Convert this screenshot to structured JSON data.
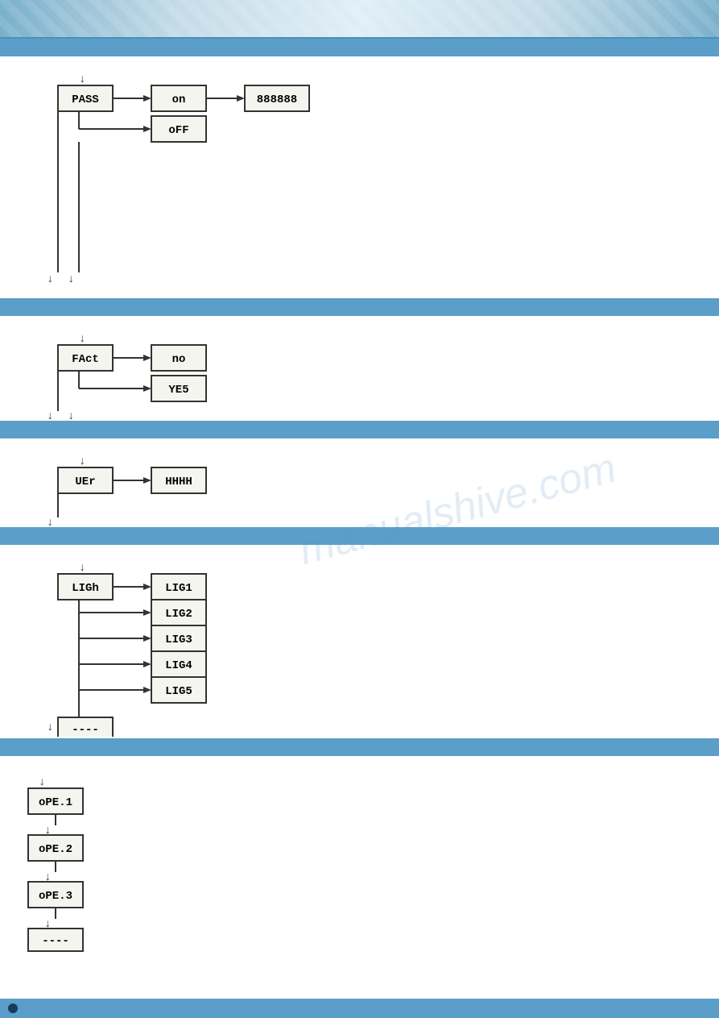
{
  "header": {
    "alt": "Product header banner"
  },
  "watermark": "manualshive.com",
  "sections": [
    {
      "id": "pass",
      "header_color": "#5b9ec9",
      "diagram": {
        "main_label": "PASS",
        "options": [
          "on",
          "oFF"
        ],
        "connected": [
          "888888"
        ]
      }
    },
    {
      "id": "fact",
      "header_color": "#5b9ec9",
      "diagram": {
        "main_label": "FAct",
        "options": [
          "no",
          "YE5"
        ]
      }
    },
    {
      "id": "uer",
      "header_color": "#5b9ec9",
      "diagram": {
        "main_label": "UEr",
        "connected": [
          "HHHH"
        ]
      }
    },
    {
      "id": "ligh",
      "header_color": "#5b9ec9",
      "diagram": {
        "main_label": "LIGh",
        "options": [
          "LIG1",
          "LIG2",
          "LIG3",
          "LIG4",
          "LIG5"
        ],
        "extra": "----"
      }
    },
    {
      "id": "ope",
      "header_color": "#5b9ec9",
      "diagram": {
        "items": [
          "oPE.1",
          "oPE.2",
          "oPE.3",
          "----"
        ]
      }
    }
  ],
  "footer": {
    "dot_color": "#1a3a5c"
  }
}
